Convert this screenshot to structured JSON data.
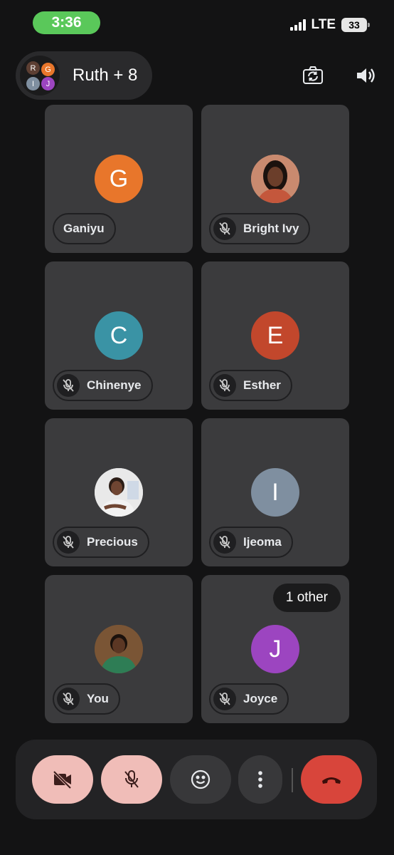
{
  "status_bar": {
    "time": "3:36",
    "network": "LTE",
    "battery": "33"
  },
  "header": {
    "title": "Ruth + 8",
    "mini_avatars": [
      {
        "letter": "R",
        "color": "#5d3f33"
      },
      {
        "letter": "G",
        "color": "#e8762b"
      },
      {
        "letter": "I",
        "color": "#7f8fa0"
      },
      {
        "letter": "J",
        "color": "#9c45c0"
      }
    ],
    "flip_camera_icon": "camera-flip-icon",
    "speaker_icon": "speaker-icon"
  },
  "participants": [
    {
      "name": "Ganiyu",
      "initial": "G",
      "color": "#e8762b",
      "muted": false,
      "photo": false
    },
    {
      "name": "Bright Ivy",
      "initial": "",
      "color": "#8a4a34",
      "muted": true,
      "photo": true
    },
    {
      "name": "Chinenye",
      "initial": "C",
      "color": "#3a93a5",
      "muted": true,
      "photo": false
    },
    {
      "name": "Esther",
      "initial": "E",
      "color": "#c2472c",
      "muted": true,
      "photo": false
    },
    {
      "name": "Precious",
      "initial": "",
      "color": "#d8d8d8",
      "muted": true,
      "photo": true
    },
    {
      "name": "Ijeoma",
      "initial": "I",
      "color": "#7f8fa0",
      "muted": true,
      "photo": false
    },
    {
      "name": "You",
      "initial": "",
      "color": "#6b4a2f",
      "muted": true,
      "photo": true
    },
    {
      "name": "Joyce",
      "initial": "J",
      "color": "#9c45c0",
      "muted": true,
      "photo": false
    }
  ],
  "other_badge": "1 other",
  "controls": {
    "camera_off": "camera-off-icon",
    "mic_off": "mic-off-icon",
    "reactions": "emoji-icon",
    "more": "more-vert-icon",
    "hang_up": "hang-up-icon"
  }
}
